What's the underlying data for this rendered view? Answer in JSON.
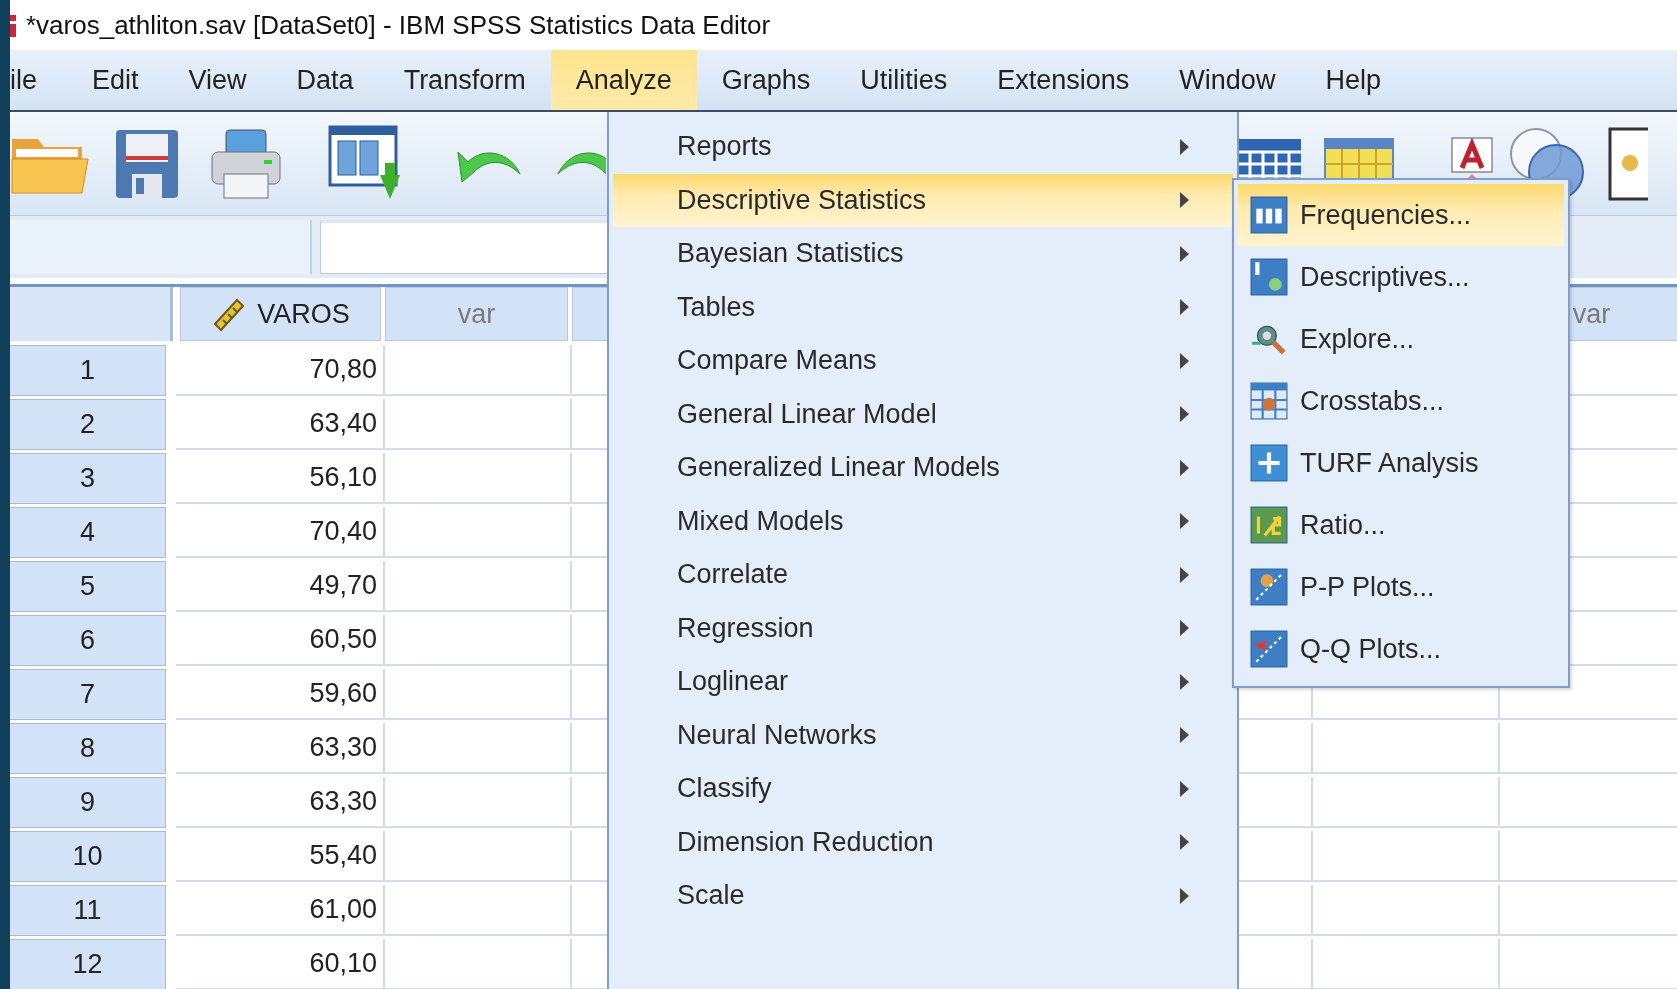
{
  "window": {
    "title": "*varos_athliton.sav [DataSet0] - IBM SPSS Statistics Data Editor"
  },
  "menu_bar": [
    {
      "label": "ile",
      "selected": false
    },
    {
      "label": "Edit",
      "selected": false
    },
    {
      "label": "View",
      "selected": false
    },
    {
      "label": "Data",
      "selected": false
    },
    {
      "label": "Transform",
      "selected": false
    },
    {
      "label": "Analyze",
      "selected": true
    },
    {
      "label": "Graphs",
      "selected": false
    },
    {
      "label": "Utilities",
      "selected": false
    },
    {
      "label": "Extensions",
      "selected": false
    },
    {
      "label": "Window",
      "selected": false
    },
    {
      "label": "Help",
      "selected": false
    }
  ],
  "table": {
    "columns": [
      {
        "label": "VAROS",
        "kind": "scale"
      },
      {
        "label": "var",
        "kind": "new"
      },
      {
        "kind": "new"
      },
      {
        "kind": "new"
      },
      {
        "kind": "new"
      },
      {
        "kind": "new"
      },
      {
        "kind": "new"
      },
      {
        "label": "var",
        "kind": "new"
      }
    ],
    "rows": [
      {
        "number": "1",
        "value": "70,80"
      },
      {
        "number": "2",
        "value": "63,40"
      },
      {
        "number": "3",
        "value": "56,10"
      },
      {
        "number": "4",
        "value": "70,40"
      },
      {
        "number": "5",
        "value": "49,70"
      },
      {
        "number": "6",
        "value": "60,50"
      },
      {
        "number": "7",
        "value": "59,60"
      },
      {
        "number": "8",
        "value": "63,30"
      },
      {
        "number": "9",
        "value": "63,30"
      },
      {
        "number": "10",
        "value": "55,40"
      },
      {
        "number": "11",
        "value": "61,00"
      },
      {
        "number": "12",
        "value": "60,10"
      }
    ]
  },
  "analyze_menu": [
    {
      "label": "Reports",
      "selected": false,
      "submenu": true
    },
    {
      "label": "Descriptive Statistics",
      "selected": true,
      "submenu": true
    },
    {
      "label": "Bayesian Statistics",
      "selected": false,
      "submenu": true
    },
    {
      "label": "Tables",
      "selected": false,
      "submenu": true
    },
    {
      "label": "Compare Means",
      "selected": false,
      "submenu": true
    },
    {
      "label": "General Linear Model",
      "selected": false,
      "submenu": true
    },
    {
      "label": "Generalized Linear Models",
      "selected": false,
      "submenu": true
    },
    {
      "label": "Mixed Models",
      "selected": false,
      "submenu": true
    },
    {
      "label": "Correlate",
      "selected": false,
      "submenu": true
    },
    {
      "label": "Regression",
      "selected": false,
      "submenu": true
    },
    {
      "label": "Loglinear",
      "selected": false,
      "submenu": true
    },
    {
      "label": "Neural Networks",
      "selected": false,
      "submenu": true
    },
    {
      "label": "Classify",
      "selected": false,
      "submenu": true
    },
    {
      "label": "Dimension Reduction",
      "selected": false,
      "submenu": true
    },
    {
      "label": "Scale",
      "selected": false,
      "submenu": true
    }
  ],
  "descriptive_submenu": [
    {
      "label": "Frequencies...",
      "selected": true
    },
    {
      "label": "Descriptives...",
      "selected": false
    },
    {
      "label": "Explore...",
      "selected": false
    },
    {
      "label": "Crosstabs...",
      "selected": false
    },
    {
      "label": "TURF Analysis",
      "selected": false
    },
    {
      "label": "Ratio...",
      "selected": false
    },
    {
      "label": "P-P Plots...",
      "selected": false
    },
    {
      "label": "Q-Q Plots...",
      "selected": false
    }
  ]
}
